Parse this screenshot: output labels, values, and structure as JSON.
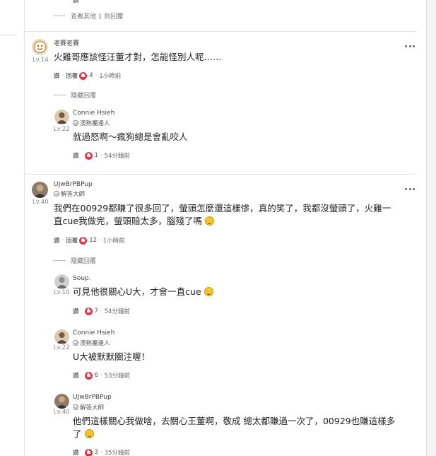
{
  "top": {
    "see_more_label": "查看其他 1 則回覆"
  },
  "labels": {
    "reply": "回覆",
    "rate": "讚",
    "sep": "·",
    "hide_replies": "隱藏回覆"
  },
  "comments": [
    {
      "username": "老賽老賽",
      "level": "Lv.14",
      "text": "火雞哥應該怪汪董才對，怎能怪別人呢……",
      "likes": "4",
      "time": "1小時前",
      "replies": [
        {
          "username": "Connie Hsieh",
          "badge": "澳熟屬達人",
          "level": "Lv.22",
          "text": "就過怒啊～瘋狗總是會亂咬人",
          "likes": "1",
          "time": "54分鐘前"
        }
      ]
    },
    {
      "username": "UJwBrPBPup",
      "badge": "解答大師",
      "level": "Lv.40",
      "text_line1": "我們在00929都賺了很多回了，螢頭怎麼還這樣慘，真的笑了，我都沒螢頭了，火雞一",
      "text_line2": "直cue我做完，螢頭賠太多，腦殘了嗎",
      "likes": "12",
      "time": "1小時前",
      "replies": [
        {
          "username": "Soup.",
          "level": "Lv.10",
          "text": "可見他很關心U大，才會一直cue",
          "likes": "7",
          "time": "54分鐘前"
        },
        {
          "username": "Connie Hsieh",
          "badge": "澳熟屬達人",
          "level": "Lv.22",
          "text": "U大被默默關注喔！",
          "likes": "6",
          "time": "53分鐘前"
        },
        {
          "username": "UJwBrPBPup",
          "badge": "解答大師",
          "level": "Lv.40",
          "text_line1": "他們這樣關心我做啥，去關心王董啊，敬成 總太都賺過一次了，00929也賺這樣多",
          "text_line2": "了",
          "likes": "3",
          "time": "35分鐘前"
        }
      ]
    }
  ],
  "colors": {
    "like": "#e0384b",
    "level": "#7d8a99",
    "divider": "#e6e6e6"
  },
  "icons": {
    "like": "thumbs-up-icon",
    "more": "more-options-icon",
    "badge": "badge-check-icon",
    "emoji": "grinning-face-emoji"
  }
}
